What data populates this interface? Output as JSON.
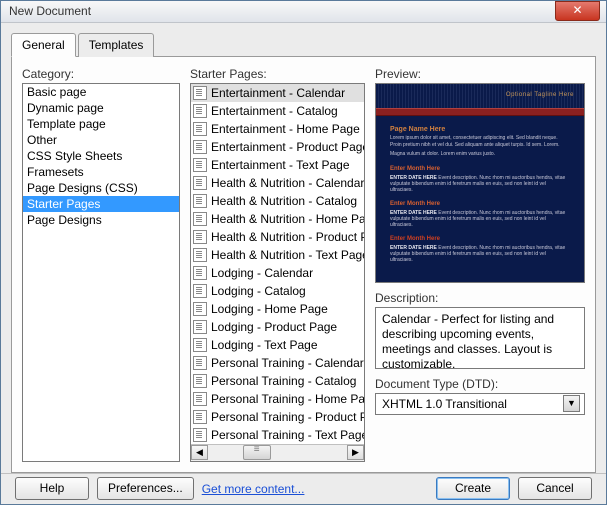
{
  "window": {
    "title": "New Document"
  },
  "tabs": {
    "general": "General",
    "templates": "Templates",
    "active": "general"
  },
  "labels": {
    "category": "Category:",
    "starter_pages": "Starter Pages:",
    "preview": "Preview:",
    "description": "Description:",
    "dtd": "Document Type (DTD):"
  },
  "categories": [
    "Basic page",
    "Dynamic page",
    "Template page",
    "Other",
    "CSS Style Sheets",
    "Framesets",
    "Page Designs (CSS)",
    "Starter Pages",
    "Page Designs"
  ],
  "category_selected_index": 7,
  "starter_pages": [
    "Entertainment - Calendar",
    "Entertainment - Catalog",
    "Entertainment - Home Page",
    "Entertainment - Product Page",
    "Entertainment - Text Page",
    "Health & Nutrition - Calendar",
    "Health & Nutrition - Catalog",
    "Health & Nutrition - Home Page",
    "Health & Nutrition - Product Page",
    "Health & Nutrition - Text Page",
    "Lodging - Calendar",
    "Lodging - Catalog",
    "Lodging - Home Page",
    "Lodging - Product Page",
    "Lodging - Text Page",
    "Personal Training - Calendar",
    "Personal Training - Catalog",
    "Personal Training - Home Page",
    "Personal Training - Product Page",
    "Personal Training - Text Page"
  ],
  "starter_selected_index": 0,
  "preview": {
    "tagline": "Optional Tagline Here",
    "page_name": "Page Name Here",
    "lorem1": "Lorem ipsum dolor sit amet, consectetuer adipiscing elit. Sed blandit neque. Proin pretium nibh et vel dui. Sed aliquam ante aliquet turpis. Id sem. Lorem.",
    "lorem2": "Magna vulum at dolor. Lorem enim varius justo.",
    "month_hdr": "Enter Month Here",
    "date_hdr": "ENTER DATE HERE",
    "event_txt": "Event description. Nunc rhom mi auctoribus hendra, vitae vulputate bibendum enim id feretrum malis en euis, sed non leint id vel ultraciaes."
  },
  "description": "Calendar - Perfect for listing and describing upcoming events, meetings and classes. Layout is customizable.",
  "dtd": {
    "selected": "XHTML 1.0 Transitional"
  },
  "footer": {
    "help": "Help",
    "preferences": "Preferences...",
    "get_more": "Get more content...",
    "create": "Create",
    "cancel": "Cancel"
  }
}
